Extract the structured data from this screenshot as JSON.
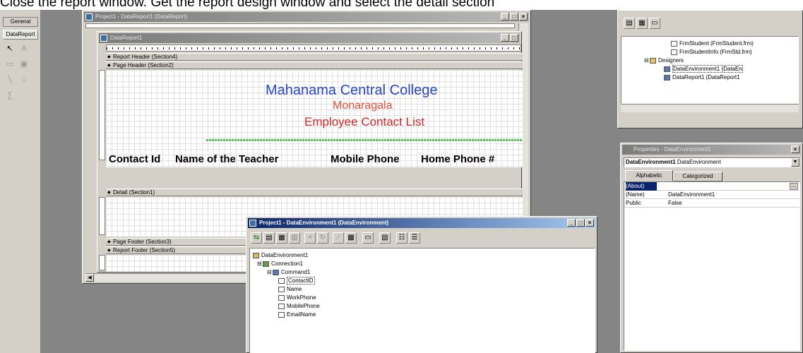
{
  "caption": "Close the report window. Get the report design window and select the detail section",
  "toolbox": {
    "tabs": [
      "General",
      "DataReport"
    ]
  },
  "project_window": {
    "title": "Project1 - DataReport1 (DataReport)"
  },
  "report_window": {
    "title": "DataReport1",
    "sections": {
      "report_header": "Report Header (Section4)",
      "page_header": "Page Header (Section2)",
      "detail": "Detail (Section1)",
      "page_footer": "Page Footer (Section3)",
      "report_footer": "Report Footer (Section5)"
    },
    "labels": {
      "college": "Mahanama Central College",
      "city": "Monaragala",
      "list_title": "Employee Contact List",
      "col_contact_id": "Contact Id",
      "col_teacher": "Name of the Teacher",
      "col_mobile": "Mobile Phone",
      "col_home": "Home Phone #"
    }
  },
  "de_window": {
    "title": "Project1 - DataEnvironment1 (DataEnvironment)",
    "tree": {
      "root": "DataEnvironment1",
      "connection": "Connection1",
      "command": "Command1",
      "fields": [
        "ContactID",
        "Name",
        "WorkPhone",
        "MobilePhone",
        "EmailName"
      ]
    }
  },
  "project_explorer": {
    "items": [
      "FrmStudent (FrmStudent.frm)",
      "FrmStudentInfo (FrmStd.frm)",
      "Designers",
      "DataEnvironment1 (DataEn",
      "DataReport1 (DataReport1"
    ]
  },
  "properties": {
    "title": "Properties - DataEnvironment1",
    "object_name": "DataEnvironment1",
    "object_type": "DataEnvironment",
    "tabs": [
      "Alphabetic",
      "Categorized"
    ],
    "rows": [
      {
        "name": "(About)",
        "value": ""
      },
      {
        "name": "(Name)",
        "value": "DataEnvironment1"
      },
      {
        "name": "Public",
        "value": "False"
      }
    ]
  },
  "colors": {
    "college": "#2a45c8",
    "city": "#e0503a",
    "list_title": "#d0282a",
    "accent": "#0a246a"
  }
}
